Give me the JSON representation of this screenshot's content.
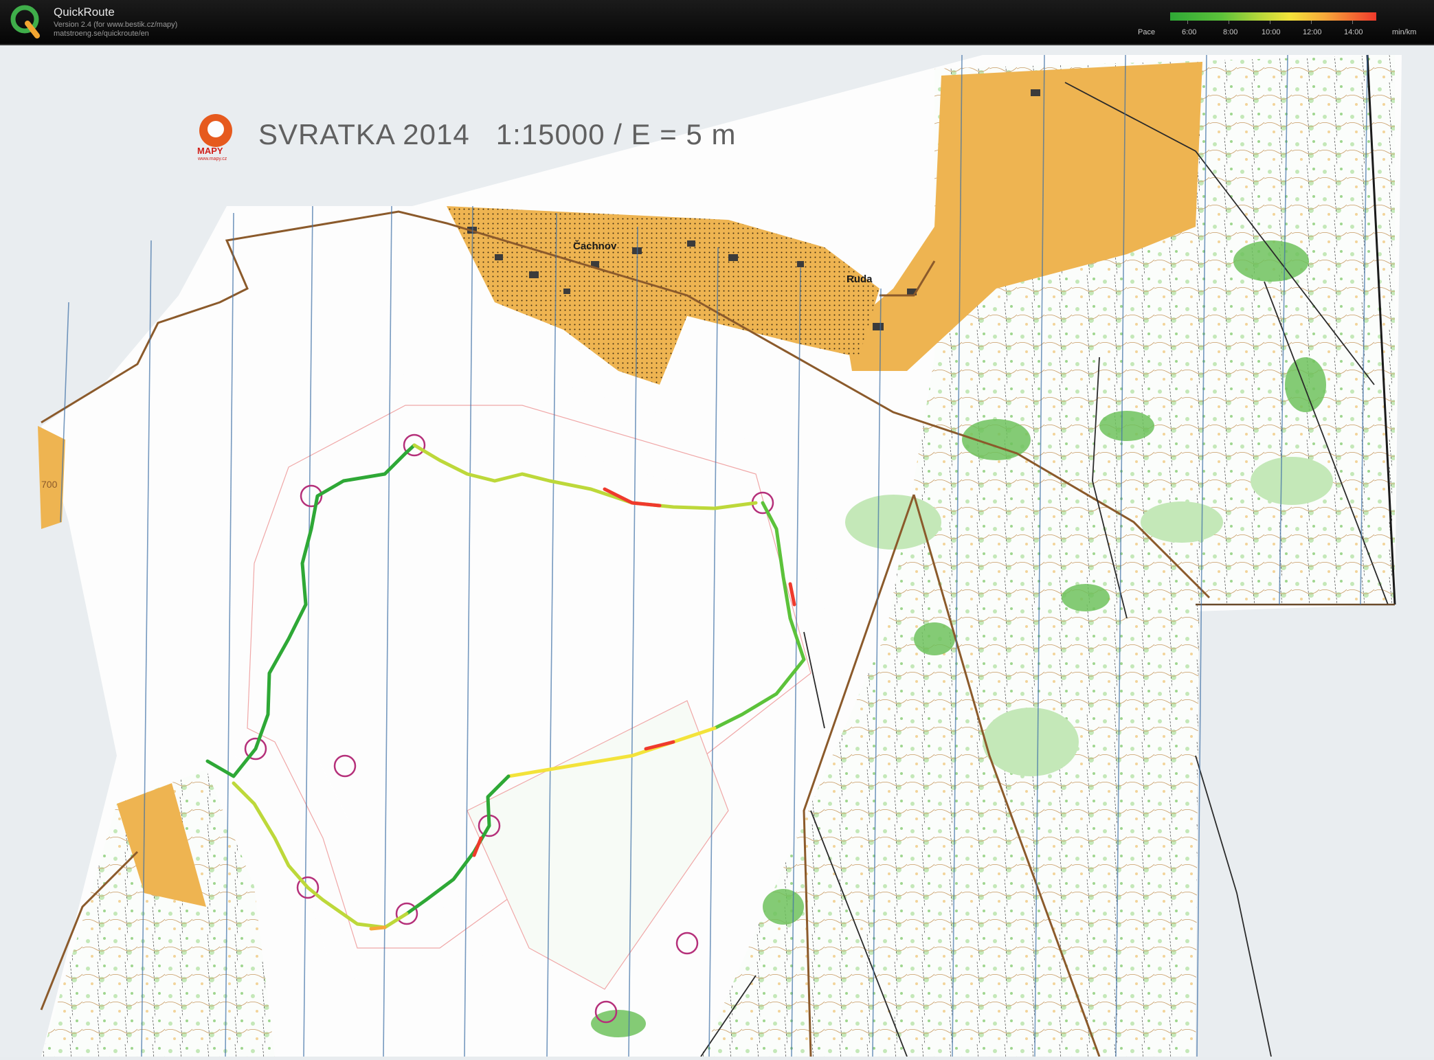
{
  "app": {
    "name": "QuickRoute",
    "version_line": "Version 2.4  (for www.bestik.cz/mapy)",
    "url_line": "matstroeng.se/quickroute/en"
  },
  "legend": {
    "label": "Pace",
    "unit": "min/km",
    "ticks": [
      "6:00",
      "8:00",
      "10:00",
      "12:00",
      "14:00"
    ],
    "colors": [
      "#2ea836",
      "#bdd83a",
      "#f3e33a",
      "#f7a83a",
      "#ef3a2c"
    ]
  },
  "map": {
    "title": "SVRATKA 2014   1:15000 / E = 5 m",
    "publisher": "MAPY",
    "publisher_url": "www.mapy.cz",
    "places": [
      "Čachnov",
      "Ruda"
    ],
    "contour_label": "700",
    "colors": {
      "paper": "#fdfdfd",
      "open_land": "#eeb451",
      "forest_green": "#6fc25d",
      "light_green": "#c4e8b8",
      "magnetic_lines": "#3d6fa6",
      "course": "#b5307a",
      "road": "#8b5a2b"
    }
  }
}
